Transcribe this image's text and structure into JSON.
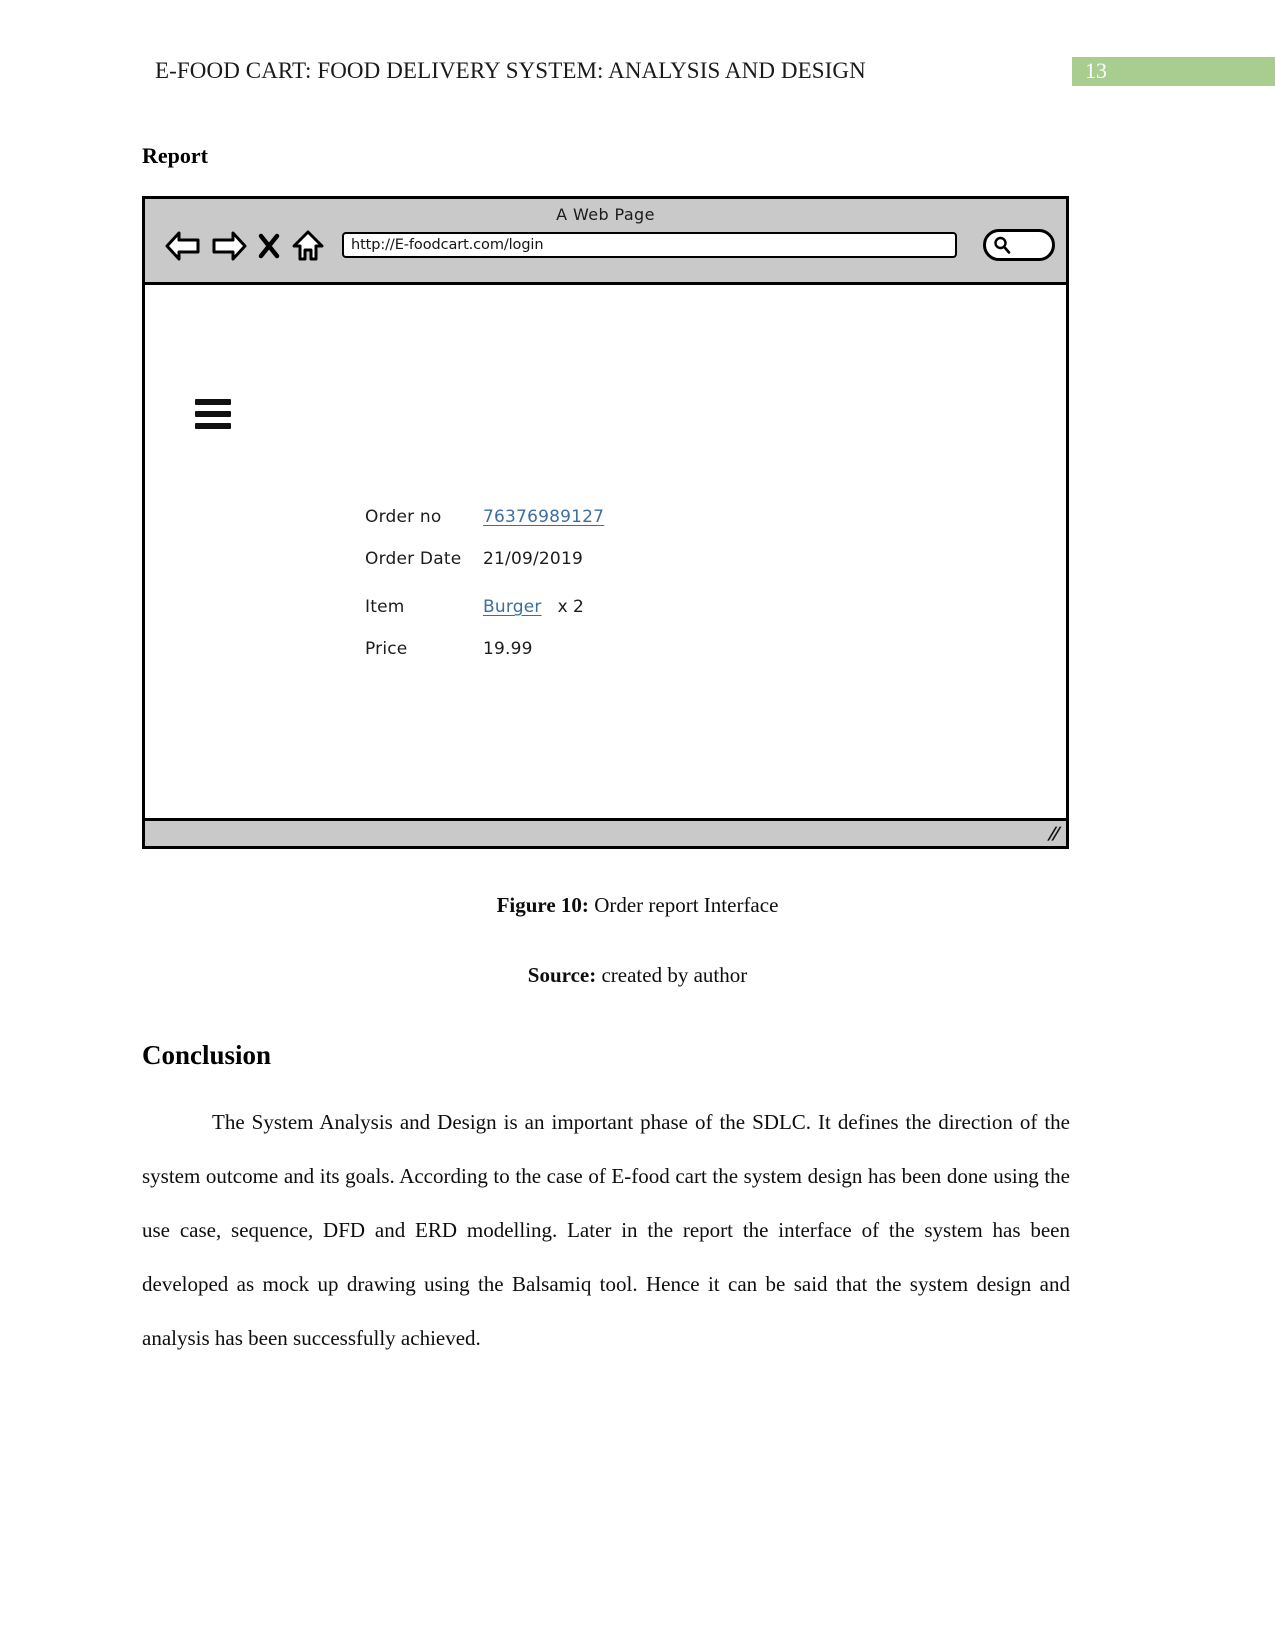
{
  "header": {
    "title": "E-FOOD CART: FOOD DELIVERY SYSTEM: ANALYSIS AND DESIGN",
    "page_number": "13",
    "badge_color": "#a9cc8f"
  },
  "sections": {
    "report_heading": "Report",
    "conclusion_heading": "Conclusion"
  },
  "wireframe": {
    "window_title": "A Web Page",
    "url": "http://E-foodcart.com/login",
    "url_placeholder": "http://",
    "search_placeholder": "",
    "nav": {
      "back_icon": "back-arrow-icon",
      "forward_icon": "forward-arrow-icon",
      "stop_icon": "close-x-icon",
      "home_icon": "home-icon",
      "search_icon": "search-icon"
    },
    "menu_icon": "hamburger-menu-icon",
    "report": {
      "rows": [
        {
          "label": "Order no",
          "value": "76376989127",
          "is_link": true,
          "suffix": ""
        },
        {
          "label": "Order Date",
          "value": "21/09/2019",
          "is_link": false,
          "suffix": ""
        },
        {
          "label": "Item",
          "value": "Burger",
          "is_link": true,
          "suffix": "x 2"
        },
        {
          "label": "Price",
          "value": "19.99",
          "is_link": false,
          "suffix": ""
        }
      ]
    },
    "resize_handle": "//"
  },
  "captions": {
    "figure_label": "Figure 10:",
    "figure_text": " Order report Interface",
    "source_label": "Source:",
    "source_text": " created by author"
  },
  "conclusion": {
    "paragraph": "The System Analysis and Design is an important phase of the SDLC. It defines the direction of the system outcome and its goals. According to the case of E-food cart the system design has been done using the use case, sequence, DFD and ERD modelling. Later in the report the interface of the system has been developed as mock up drawing using the Balsamiq tool. Hence it can be said that the system design and analysis has been successfully achieved."
  }
}
